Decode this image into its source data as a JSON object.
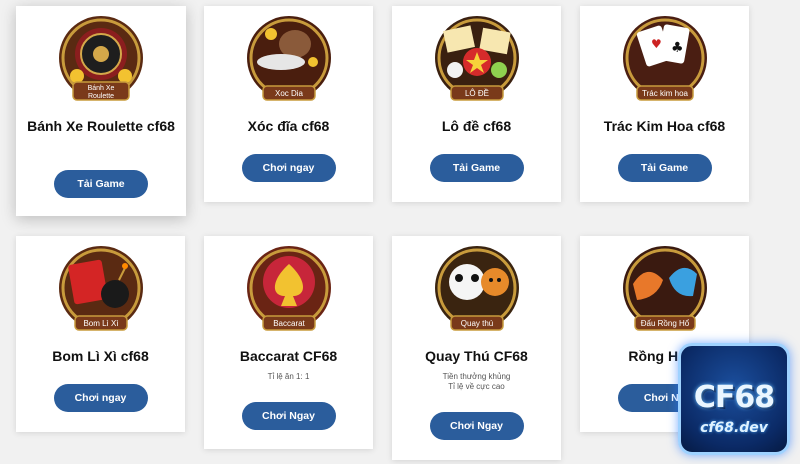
{
  "cards": [
    {
      "title": "Bánh Xe Roulette cf68",
      "badge": "Bánh Xe Roulette",
      "button": "Tải Game",
      "icon": "roulette-icon"
    },
    {
      "title": "Xóc đĩa cf68",
      "badge": "Xoc Dia",
      "button": "Chơi ngay",
      "icon": "xoc-dia-icon"
    },
    {
      "title": "Lô đề cf68",
      "badge": "LÔ ĐỀ",
      "button": "Tải Game",
      "icon": "lottery-icon"
    },
    {
      "title": "Trác Kim Hoa cf68",
      "badge": "Trác kim hoa",
      "button": "Tải Game",
      "icon": "playing-cards-icon"
    },
    {
      "title": "Bom Lì Xì cf68",
      "badge": "Bom Lì Xì",
      "button": "Chơi ngay",
      "icon": "red-envelope-bomb-icon"
    },
    {
      "title": "Baccarat CF68",
      "badge": "Baccarat",
      "sub1": "Tỉ lệ ăn 1: 1",
      "button": "Chơi Ngay",
      "icon": "baccarat-icon"
    },
    {
      "title": "Quay Thú CF68",
      "badge": "Quay thú",
      "sub1": "Tiền thưởng khủng",
      "sub2": "Tỉ lệ về cực cao",
      "button": "Chơi Ngay",
      "icon": "animal-spin-icon"
    },
    {
      "title": "Rồng Hổ C",
      "badge": "Đấu Rồng Hổ",
      "button": "Chơi Ng",
      "icon": "dragon-tiger-icon"
    }
  ],
  "logo": {
    "big": "CF68",
    "small": "cf68.dev"
  },
  "colors": {
    "button": "#2b5d9c",
    "card": "#ffffff",
    "background": "#f1f1f1",
    "badge": "#7a3a1a",
    "rim": "#c89b3c"
  }
}
